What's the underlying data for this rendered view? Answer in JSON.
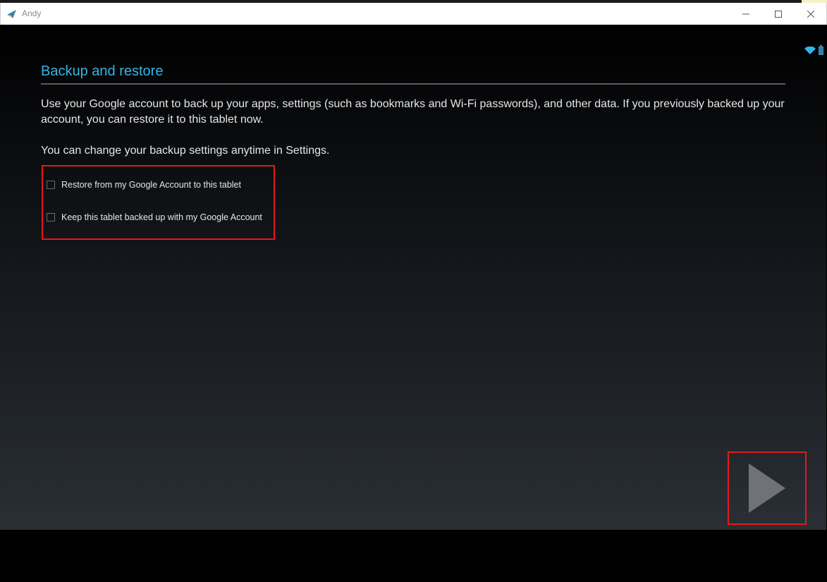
{
  "window": {
    "title": "Andy"
  },
  "page": {
    "heading": "Backup and restore",
    "description": "Use your Google account to back up your apps, settings (such as bookmarks and Wi-Fi passwords), and other data. If you previously backed up your account, you can restore it to this tablet now.",
    "note": "You can change your backup settings anytime in Settings."
  },
  "options": [
    {
      "label": "Restore from my Google Account to this tablet",
      "checked": false
    },
    {
      "label": "Keep this tablet backed up with my Google Account",
      "checked": false
    }
  ],
  "colors": {
    "accent": "#33b5e5",
    "highlight": "#e01b1b",
    "next_arrow": "#6f7377"
  },
  "icons": {
    "app": "andy-logo-icon",
    "wifi": "wifi-icon",
    "battery": "battery-icon",
    "next": "next-arrow-icon"
  }
}
